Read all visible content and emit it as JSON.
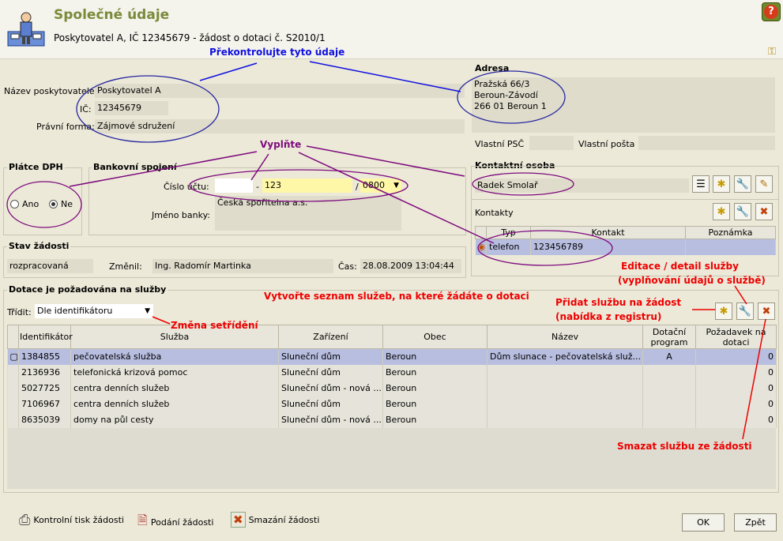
{
  "header": {
    "title": "Společné údaje",
    "subtitle": "Poskytovatel A, IČ 12345679 - žádost o dotaci č. S2010/1",
    "help_icon": "question-icon",
    "settings_icon": "key-icon"
  },
  "annotations": {
    "check": "Překontrolujte tyto údaje",
    "fill": "Vyplňte",
    "list": "Vytvořte seznam služeb, na které žádáte o dotaci",
    "sort": "Změna setřídění",
    "edit1": "Editace / detail služby",
    "edit2": "(vyplňování údajů o službě)",
    "add1": "Přidat službu na žádost",
    "add2": "(nabídka z registru)",
    "delete": "Smazat službu ze žádosti"
  },
  "provider": {
    "name_label": "Název poskytovatele:",
    "name": "Poskytovatel A",
    "ic_label": "IČ:",
    "ic": "12345679",
    "form_label": "Právní forma:",
    "form": "Zájmové sdružení"
  },
  "address": {
    "title": "Adresa",
    "line1": "Pražská 66/3",
    "line2": "Beroun-Závodí",
    "line3": "266 01 Beroun 1",
    "psc_label": "Vlastní PSČ",
    "post_label": "Vlastní pošta"
  },
  "vat": {
    "title": "Plátce DPH",
    "yes": "Ano",
    "no": "Ne",
    "selected": "Ne"
  },
  "bank": {
    "title": "Bankovní spojení",
    "account_label": "Číslo účtu:",
    "prefix": "",
    "account": "123",
    "code": "0800",
    "bank_label": "Jméno banky:",
    "bank_name": "Česká spořitelna a.s."
  },
  "contact": {
    "title": "Kontaktní osoba",
    "name": "Radek Smolař",
    "contacts_label": "Kontakty",
    "columns": [
      "Typ",
      "Kontakt",
      "Poznámka"
    ],
    "rows": [
      {
        "type": "telefon",
        "value": "123456789",
        "note": ""
      }
    ]
  },
  "status": {
    "title": "Stav žádosti",
    "state": "rozpracovaná",
    "changed_label": "Změnil:",
    "changed_by": "Ing. Radomír Martinka",
    "time_label": "Čas:",
    "time": "28.08.2009 13:04:44"
  },
  "services": {
    "title": "Dotace je požadována na služby",
    "sort_label": "Třídit:",
    "sort_value": "Dle identifikátoru",
    "columns": [
      "Identifikátor",
      "Služba",
      "Zařízení",
      "Obec",
      "Název",
      "Dotační program",
      "Požadavek na dotaci"
    ],
    "rows": [
      {
        "id": "1384855",
        "service": "pečovatelská služba",
        "facility": "Sluneční dům",
        "town": "Beroun",
        "name": "Dům slunace - pečovatelská služ...",
        "program": "A",
        "amount": "0"
      },
      {
        "id": "2136936",
        "service": "telefonická krizová pomoc",
        "facility": "Sluneční dům",
        "town": "Beroun",
        "name": "",
        "program": "",
        "amount": "0"
      },
      {
        "id": "5027725",
        "service": "centra denních služeb",
        "facility": "Sluneční dům - nová ...",
        "town": "Beroun",
        "name": "",
        "program": "",
        "amount": "0"
      },
      {
        "id": "7106967",
        "service": "centra denních služeb",
        "facility": "Sluneční dům",
        "town": "Beroun",
        "name": "",
        "program": "",
        "amount": "0"
      },
      {
        "id": "8635039",
        "service": "domy na půl cesty",
        "facility": "Sluneční dům - nová ...",
        "town": "Beroun",
        "name": "",
        "program": "",
        "amount": "0"
      }
    ]
  },
  "footer": {
    "print": "Kontrolní tisk žádosti",
    "submit": "Podání žádosti",
    "delete": "Smazání žádosti",
    "ok": "OK",
    "back": "Zpět"
  }
}
